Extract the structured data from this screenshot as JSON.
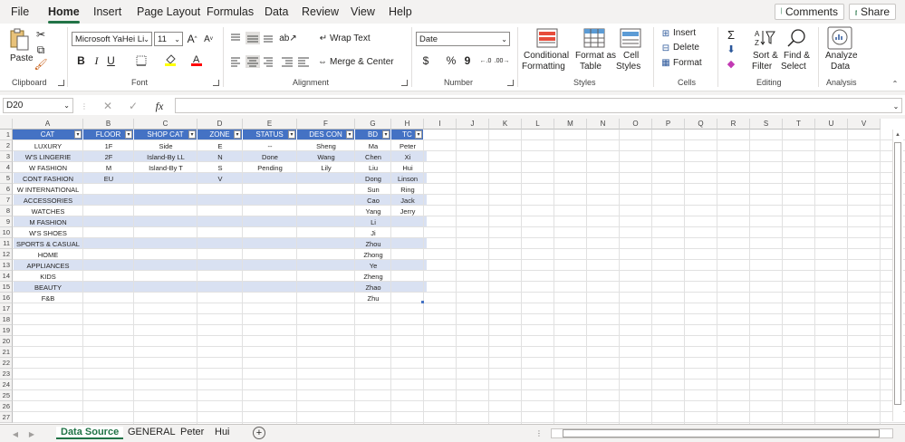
{
  "menu": [
    "File",
    "Home",
    "Insert",
    "Page Layout",
    "Formulas",
    "Data",
    "Review",
    "View",
    "Help"
  ],
  "active_tab": "Home",
  "top_buttons": {
    "comments": "Comments",
    "share": "Share"
  },
  "clipboard": {
    "paste": "Paste",
    "group": "Clipboard"
  },
  "font": {
    "name": "Microsoft YaHei Li",
    "size": "11",
    "group": "Font",
    "grow": "A",
    "shrink": "A",
    "bold": "B",
    "italic": "I",
    "underline": "U"
  },
  "alignment": {
    "wrap": "Wrap Text",
    "merge": "Merge & Center",
    "group": "Alignment"
  },
  "number": {
    "format": "Date",
    "currency": "$",
    "percent": "%",
    "comma": "9",
    "group": "Number"
  },
  "styles": {
    "conditional": "Conditional",
    "formatting": "Formatting",
    "format_as": "Format as",
    "table": "Table",
    "cell": "Cell",
    "styles_lbl": "Styles",
    "group": "Styles"
  },
  "cells": {
    "insert": "Insert",
    "delete": "Delete",
    "format": "Format",
    "group": "Cells"
  },
  "editing": {
    "sort": "Sort &",
    "filter": "Filter",
    "find": "Find &",
    "select": "Select",
    "group": "Editing"
  },
  "analysis": {
    "analyze": "Analyze",
    "data": "Data",
    "group": "Analysis"
  },
  "namebox": "D20",
  "fx": "fx",
  "columns": [
    "A",
    "B",
    "C",
    "D",
    "E",
    "F",
    "G",
    "H",
    "I",
    "J",
    "K",
    "L",
    "M",
    "N",
    "O",
    "P",
    "Q",
    "R",
    "S",
    "T",
    "U",
    "V"
  ],
  "rows": [
    "1",
    "2",
    "3",
    "4",
    "5",
    "6",
    "7",
    "8",
    "9",
    "10",
    "11",
    "12",
    "13",
    "14",
    "15",
    "16",
    "17",
    "18",
    "19",
    "20",
    "21",
    "22",
    "23",
    "24",
    "25",
    "26",
    "27"
  ],
  "table": {
    "headers": [
      "CAT",
      "FLOOR",
      "SHOP CAT",
      "ZONE",
      "STATUS",
      "DES CON",
      "BD",
      "TC"
    ],
    "rows": [
      [
        "LUXURY",
        "1F",
        "Side",
        "E",
        "--",
        "Sheng",
        "Ma",
        "Peter"
      ],
      [
        "W'S LINGERIE",
        "2F",
        "Island-By LL",
        "N",
        "Done",
        "Wang",
        "Chen",
        "Xi"
      ],
      [
        "W FASHION",
        "M",
        "Island-By T",
        "S",
        "Pending",
        "Lily",
        "Liu",
        "Hui"
      ],
      [
        "CONT FASHION",
        "EU",
        "",
        "V",
        "",
        "",
        "Dong",
        "Linson"
      ],
      [
        "W INTERNATIONAL",
        "",
        "",
        "",
        "",
        "",
        "Sun",
        "Ring"
      ],
      [
        "ACCESSORIES",
        "",
        "",
        "",
        "",
        "",
        "Cao",
        "Jack"
      ],
      [
        "WATCHES",
        "",
        "",
        "",
        "",
        "",
        "Yang",
        "Jerry"
      ],
      [
        "M FASHION",
        "",
        "",
        "",
        "",
        "",
        "Li",
        ""
      ],
      [
        "W'S SHOES",
        "",
        "",
        "",
        "",
        "",
        "Ji",
        ""
      ],
      [
        "SPORTS & CASUAL",
        "",
        "",
        "",
        "",
        "",
        "Zhou",
        ""
      ],
      [
        "HOME",
        "",
        "",
        "",
        "",
        "",
        "Zhong",
        ""
      ],
      [
        "APPLIANCES",
        "",
        "",
        "",
        "",
        "",
        "Ye",
        ""
      ],
      [
        "KIDS",
        "",
        "",
        "",
        "",
        "",
        "Zheng",
        ""
      ],
      [
        "BEAUTY",
        "",
        "",
        "",
        "",
        "",
        "Zhao",
        ""
      ],
      [
        "F&B",
        "",
        "",
        "",
        "",
        "",
        "Zhu",
        ""
      ]
    ]
  },
  "sheets": [
    "Data Source",
    "GENERAL",
    "Peter",
    "Hui"
  ],
  "active_sheet": "Data Source",
  "accent": "#217346",
  "header_fill": "#4472c4",
  "band_fill": "#d9e1f2"
}
